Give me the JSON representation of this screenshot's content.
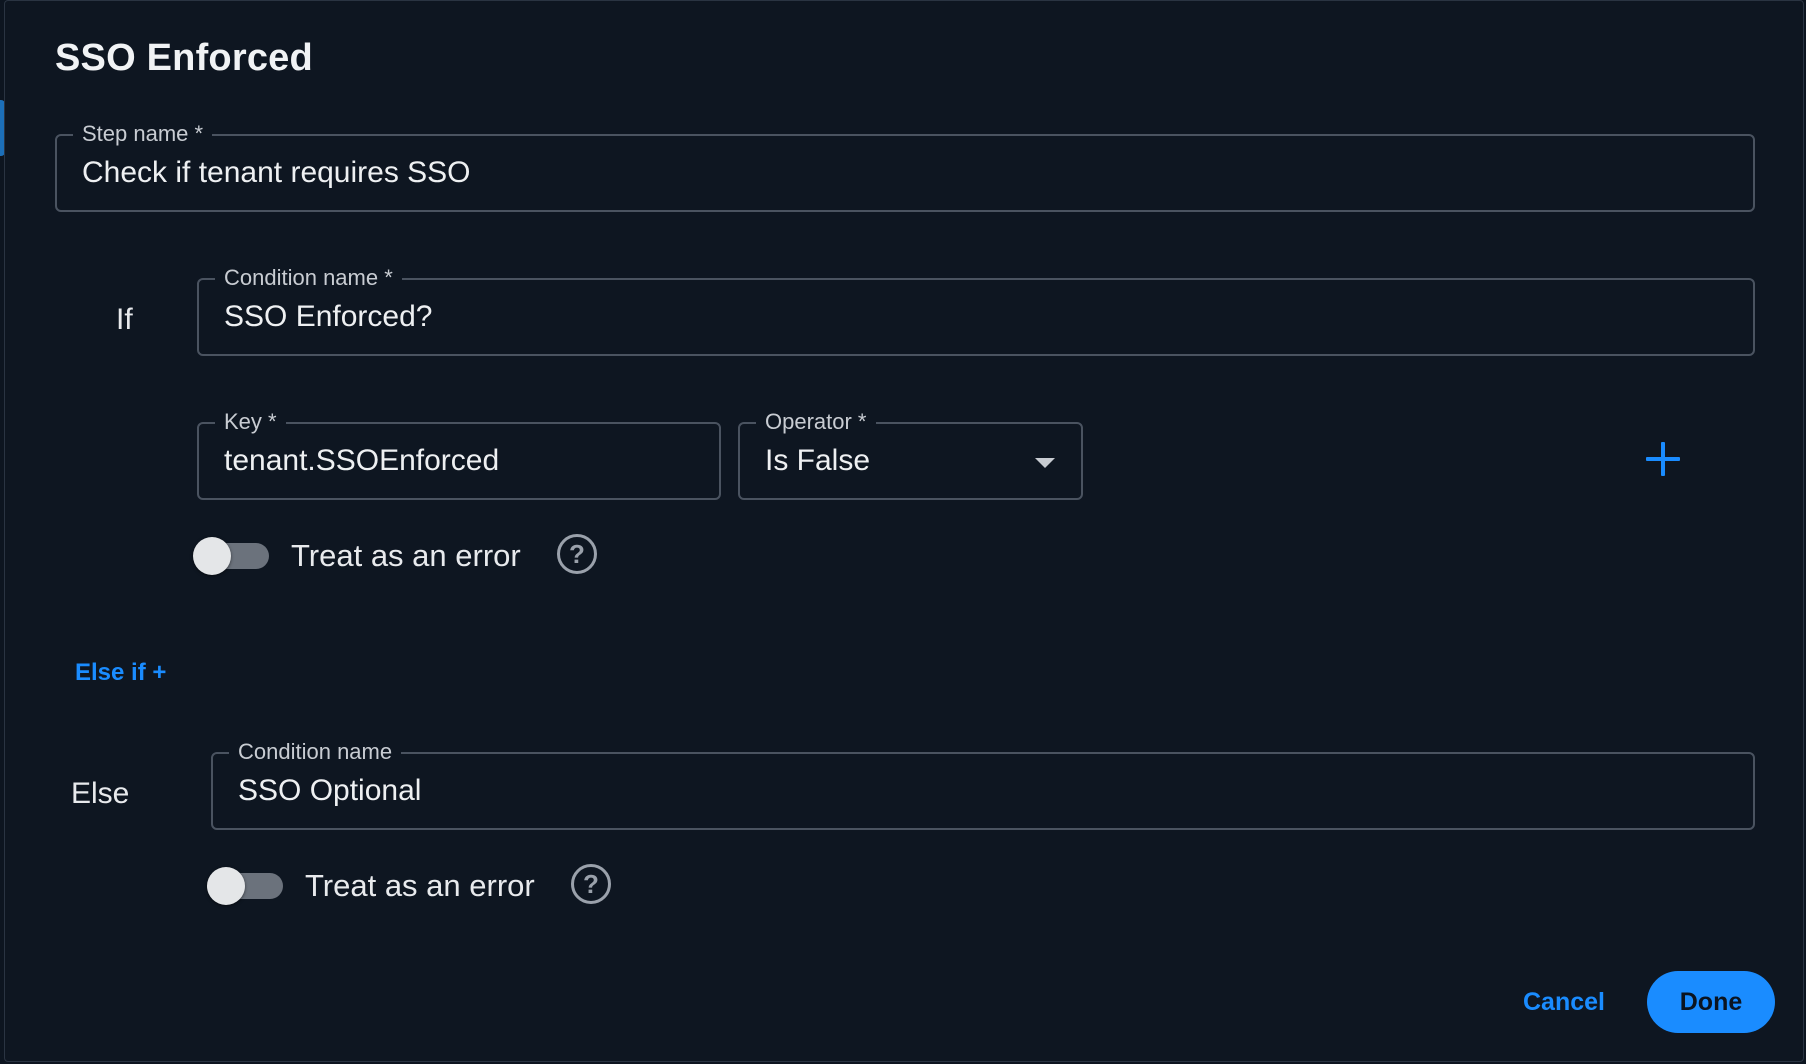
{
  "dialog": {
    "title": "SSO Enforced"
  },
  "step_name": {
    "label": "Step name *",
    "value": "Check if tenant requires SSO"
  },
  "if_block": {
    "label": "If",
    "condition_name": {
      "label": "Condition name *",
      "value": "SSO Enforced?"
    },
    "key": {
      "label": "Key *",
      "value": "tenant.SSOEnforced"
    },
    "operator": {
      "label": "Operator *",
      "selected": "Is False"
    },
    "treat_as_error": {
      "label": "Treat as an error",
      "enabled": false
    },
    "help_symbol": "?"
  },
  "else_if_link": "Else if +",
  "else_block": {
    "label": "Else",
    "condition_name": {
      "label": "Condition name",
      "value": "SSO Optional"
    },
    "treat_as_error": {
      "label": "Treat as an error",
      "enabled": false
    },
    "help_symbol": "?"
  },
  "footer": {
    "cancel_label": "Cancel",
    "done_label": "Done"
  },
  "colors": {
    "accent": "#1a8cff",
    "background": "#0e1621",
    "border": "#4a5360"
  }
}
